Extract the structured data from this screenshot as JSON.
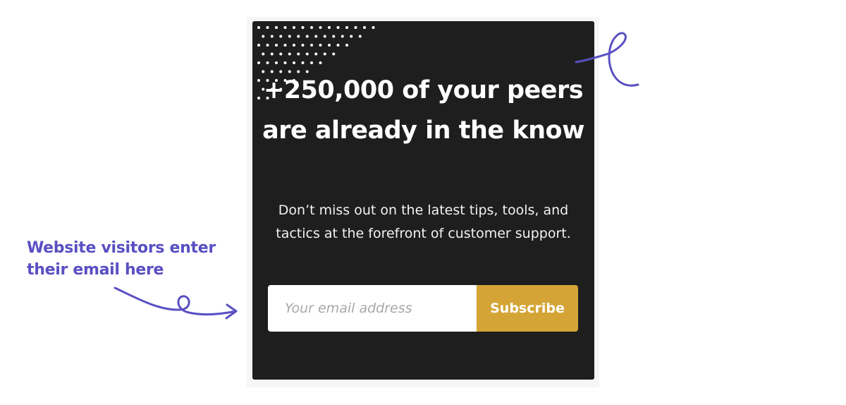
{
  "signup_card": {
    "headline": "+250,000 of your peers are already in the know",
    "subtext": "Don’t miss out on the latest tips, tools, and tactics at the forefront of customer support.",
    "email_placeholder": "Your email address",
    "subscribe_label": "Subscribe"
  },
  "annotation": {
    "text": "Website visitors enter their email here"
  },
  "colors": {
    "card_background": "#1e1e1e",
    "accent_button": "#d4a536",
    "annotation": "#5a4fc2"
  },
  "icons": {
    "decoration": "dot-pattern-icon",
    "pointer": "curly-arrow-icon",
    "flourish": "squiggle-icon"
  }
}
